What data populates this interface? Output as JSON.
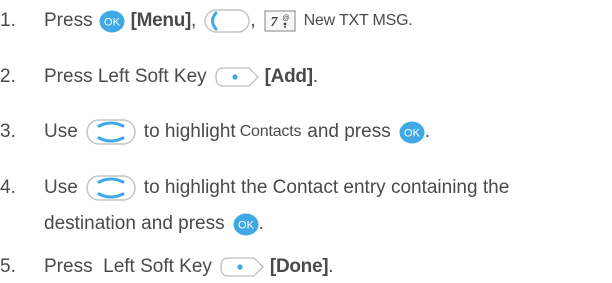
{
  "colors": {
    "ok_fill": "#3fa9e6",
    "ok_text": "#ffffff",
    "nav_outline": "#b9b9b9",
    "nav_arc": "#3fa9e6",
    "softkey_dot": "#3fa9e6",
    "text": "#4a4a4a"
  },
  "icons": {
    "ok": "ok-key-icon",
    "nav": "navigation-key-icon",
    "softkey": "left-soft-key-icon",
    "left_button": "left-button-icon",
    "key7": "seven-pqrs-key-icon"
  },
  "key7": {
    "digit": "7",
    "sub": "@"
  },
  "ok_label": "OK",
  "steps": [
    {
      "number": "1.",
      "press": "Press",
      "menu": "[Menu]",
      "comma1": ",",
      "comma2": ",",
      "dest": "New TXT MSG."
    },
    {
      "number": "2.",
      "text": "Press Left Soft Key",
      "label": "[Add]",
      "end": "."
    },
    {
      "number": "3.",
      "use": "Use",
      "mid": "to highlight",
      "target": "Contacts",
      "and_press": "and press",
      "end": "."
    },
    {
      "number": "4.",
      "use": "Use",
      "mid": "to highlight the Contact entry containing the",
      "line2": "destination and press",
      "end": "."
    },
    {
      "number": "5.",
      "text": "Press  Left Soft Key",
      "label": "[Done]",
      "end": "."
    }
  ]
}
